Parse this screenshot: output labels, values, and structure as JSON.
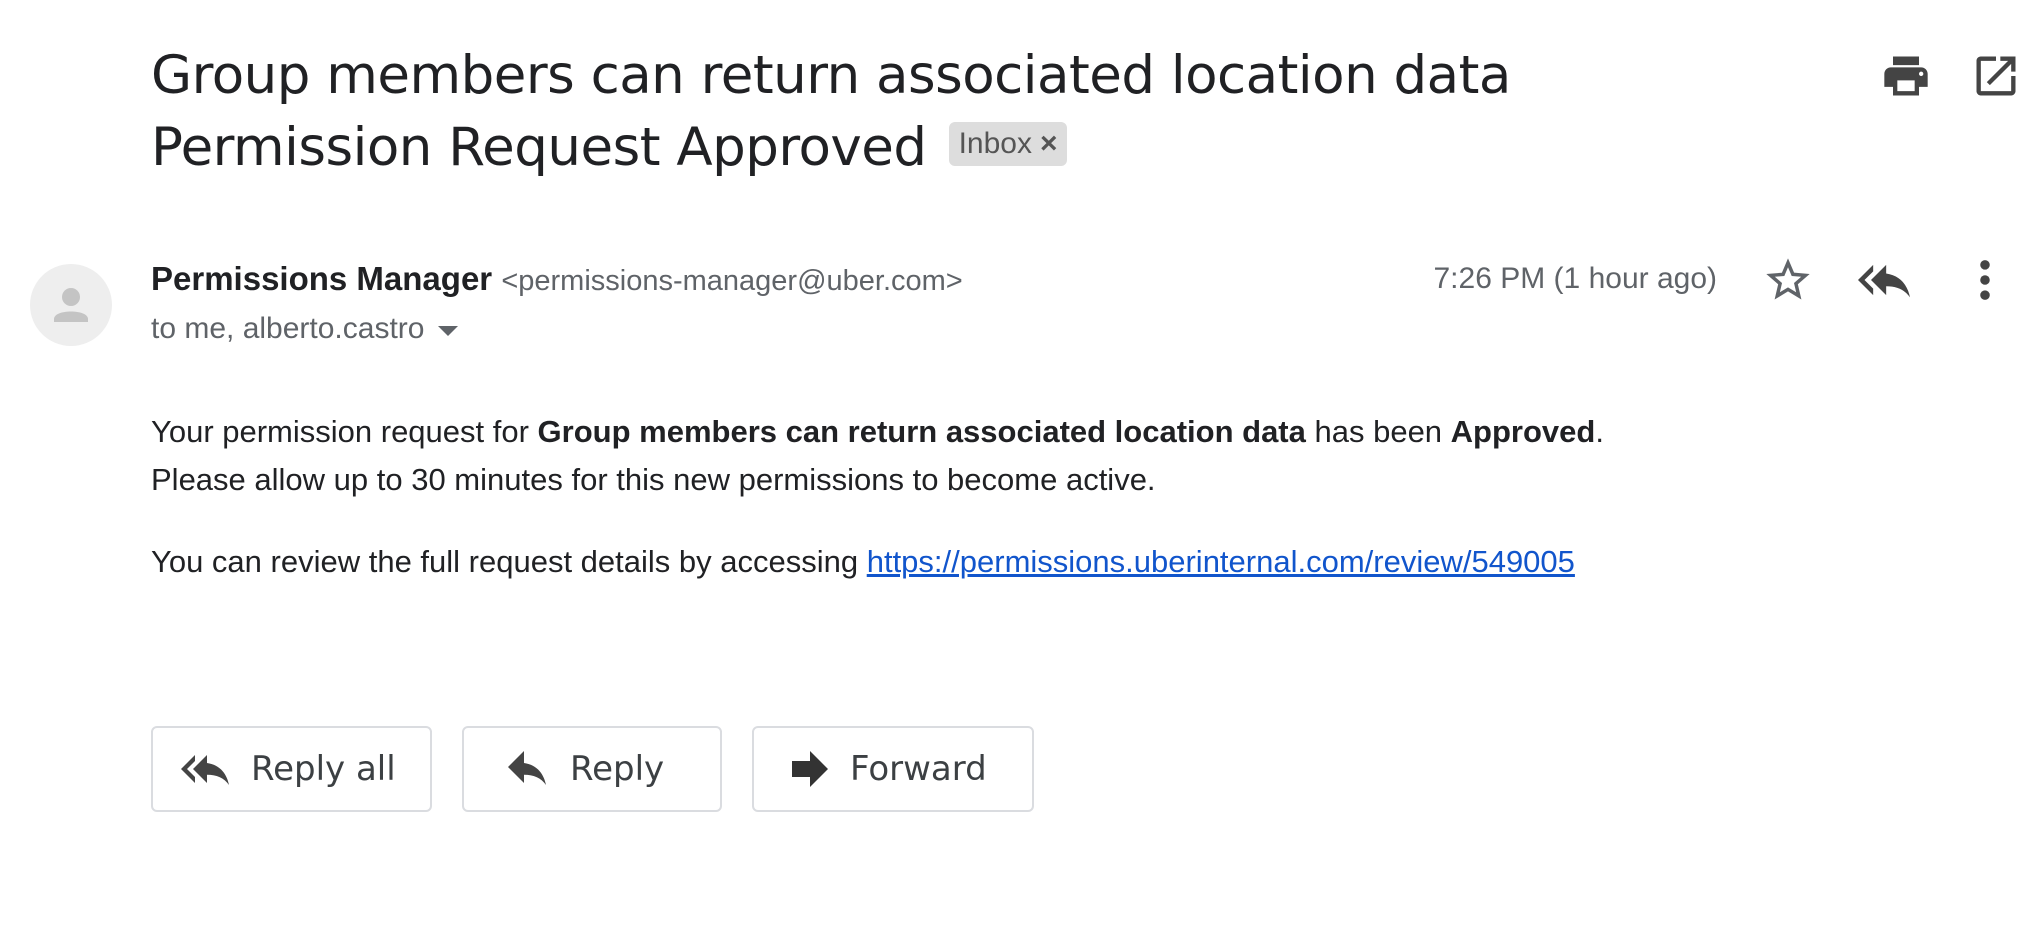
{
  "email": {
    "subject": "Group members can return associated location data Permission Request Approved",
    "label_chip": {
      "text": "Inbox",
      "close_glyph": "×"
    },
    "sender": {
      "name": "Permissions Manager",
      "email": "<permissions-manager@uber.com>"
    },
    "recipients": "to me, alberto.castro",
    "timestamp": "7:26 PM (1 hour ago)",
    "body": {
      "line1_prefix": "Your permission request for ",
      "line1_bold_request": "Group members can return associated location data",
      "line1_middle": " has been ",
      "line1_bold_status": "Approved",
      "line1_suffix": ".",
      "line2": "Please allow up to 30 minutes for this new permissions to become active.",
      "para2_prefix": "You can review the full request details by accessing ",
      "review_link": "https://permissions.uberinternal.com/review/549005"
    }
  },
  "actions": {
    "reply_all_label": "Reply all",
    "reply_label": "Reply",
    "forward_label": "Forward"
  },
  "icons": {
    "print": "print-icon",
    "open_new_window": "open-in-new-window-icon",
    "avatar": "person-icon",
    "star": "star-outline-icon",
    "reply_all": "reply-all-icon",
    "more": "more-vert-icon",
    "reply": "reply-icon",
    "forward": "forward-icon"
  },
  "colors": {
    "text_primary": "#202124",
    "text_secondary": "#5f6368",
    "link": "#1155cc",
    "chip_background": "#dddddd",
    "button_border": "#dadce0",
    "icon_dark": "#444444"
  }
}
